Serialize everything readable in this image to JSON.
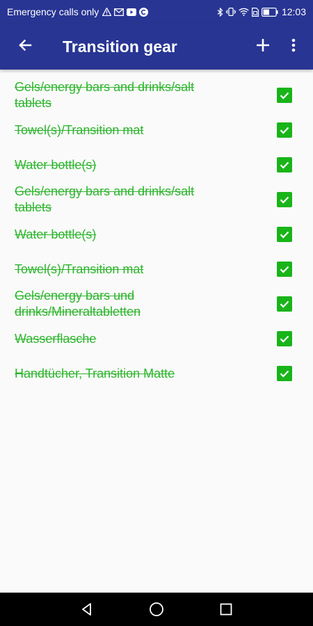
{
  "status_bar": {
    "carrier": "Emergency calls only",
    "battery": "42",
    "time": "12:03"
  },
  "toolbar": {
    "title": "Transition gear"
  },
  "items": [
    {
      "text": "Gels/energy bars and drinks/salt tablets",
      "checked": true
    },
    {
      "text": "Towel(s)/Transition mat",
      "checked": true
    },
    {
      "text": "Water bottle(s)",
      "checked": true
    },
    {
      "text": "Gels/energy bars and drinks/salt tablets",
      "checked": true
    },
    {
      "text": "Water bottle(s)",
      "checked": true
    },
    {
      "text": "Towel(s)/Transition mat",
      "checked": true
    },
    {
      "text": "Gels/energy bars und drinks/Mineraltabletten",
      "checked": true
    },
    {
      "text": "Wasserflasche",
      "checked": true
    },
    {
      "text": "Handtücher, Transition Matte",
      "checked": true
    }
  ],
  "colors": {
    "primary": "#283593",
    "checked_text": "#2db52d",
    "checkbox": "#19b419"
  }
}
